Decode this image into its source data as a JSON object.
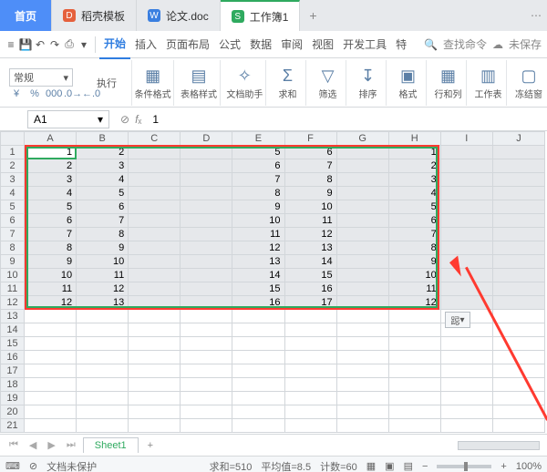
{
  "tabs": {
    "home": "首页",
    "dao": "稻壳模板",
    "doc": "论文.doc",
    "book": "工作簿1",
    "plus": "+"
  },
  "ribbon": {
    "items": [
      "开始",
      "插入",
      "页面布局",
      "公式",
      "数据",
      "审阅",
      "视图",
      "开发工具",
      "特"
    ],
    "search_placeholder": "查找命令",
    "unsaved": "未保存"
  },
  "toolbar": {
    "row_label": "执行",
    "fmt_value": "常规",
    "btns": {
      "cond": "条件格式",
      "style": "表格样式",
      "helper": "文档助手",
      "sum": "求和",
      "filter": "筛选",
      "sort": "排序",
      "format": "格式",
      "rowcol": "行和列",
      "sheet": "工作表",
      "freeze": "冻结窗"
    }
  },
  "fx": {
    "name": "A1",
    "formula": "1"
  },
  "columns": [
    "A",
    "B",
    "C",
    "D",
    "E",
    "F",
    "G",
    "H",
    "I",
    "J"
  ],
  "rows": [
    {
      "n": 1,
      "A": "1",
      "B": "2",
      "E": "5",
      "F": "6",
      "H": "1"
    },
    {
      "n": 2,
      "A": "2",
      "B": "3",
      "E": "6",
      "F": "7",
      "H": "2"
    },
    {
      "n": 3,
      "A": "3",
      "B": "4",
      "E": "7",
      "F": "8",
      "H": "3"
    },
    {
      "n": 4,
      "A": "4",
      "B": "5",
      "E": "8",
      "F": "9",
      "H": "4"
    },
    {
      "n": 5,
      "A": "5",
      "B": "6",
      "E": "9",
      "F": "10",
      "H": "5"
    },
    {
      "n": 6,
      "A": "6",
      "B": "7",
      "E": "10",
      "F": "11",
      "H": "6"
    },
    {
      "n": 7,
      "A": "7",
      "B": "8",
      "E": "11",
      "F": "12",
      "H": "7"
    },
    {
      "n": 8,
      "A": "8",
      "B": "9",
      "E": "12",
      "F": "13",
      "H": "8"
    },
    {
      "n": 9,
      "A": "9",
      "B": "10",
      "E": "13",
      "F": "14",
      "H": "9"
    },
    {
      "n": 10,
      "A": "10",
      "B": "11",
      "E": "14",
      "F": "15",
      "H": "10"
    },
    {
      "n": 11,
      "A": "11",
      "B": "12",
      "E": "15",
      "F": "16",
      "H": "11"
    },
    {
      "n": 12,
      "A": "12",
      "B": "13",
      "E": "16",
      "F": "17",
      "H": "12"
    }
  ],
  "extra_row_count": 9,
  "float_fmt": "跽",
  "sheet_tabs": {
    "name": "Sheet1"
  },
  "status": {
    "protect": "文档未保护",
    "sum": "求和=510",
    "avg": "平均值=8.5",
    "count": "计数=60",
    "zoom": "100%"
  }
}
